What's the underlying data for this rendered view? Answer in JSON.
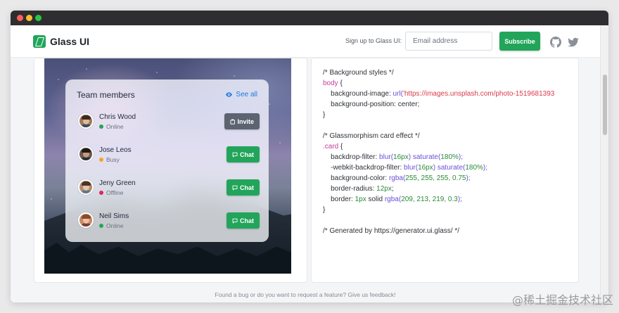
{
  "window": {
    "title": ""
  },
  "nav": {
    "brand": "Glass UI",
    "signup_label": "Sign up to Glass UI:",
    "email_placeholder": "Email address",
    "subscribe_label": "Subscribe",
    "icons": [
      "github-icon",
      "twitter-icon"
    ]
  },
  "card": {
    "title": "Team members",
    "see_all": "See all",
    "members": [
      {
        "name": "Chris Wood",
        "status": "Online",
        "status_color": "#22a55a",
        "action": "Invite"
      },
      {
        "name": "Jose Leos",
        "status": "Busy",
        "status_color": "#f5a524",
        "action": "Chat"
      },
      {
        "name": "Jeny Green",
        "status": "Offline",
        "status_color": "#e0245e",
        "action": "Chat"
      },
      {
        "name": "Neil Sims",
        "status": "Online",
        "status_color": "#22a55a",
        "action": "Chat"
      }
    ]
  },
  "code": {
    "l1": "/* Background styles */",
    "l2_sel": "body",
    "l2_brace": " {",
    "l3_prop": "    background-image: ",
    "l3_fn": "url(",
    "l3_str": "'https://images.unsplash.com/photo-1519681393",
    "l4": "    background-position: center;",
    "l5": "}",
    "l6": "/* Glassmorphism card effect */",
    "l7_sel": ".card",
    "l7_brace": " {",
    "l8_prop": "    backdrop-filter: ",
    "l8_fn1": "blur(",
    "l8_num1": "16px",
    "l8_fn1_end": ")",
    "l8_fn2": " saturate(",
    "l8_num2": "180%",
    "l8_end": ");",
    "l9_prop": "    -webkit-backdrop-filter: ",
    "l9_fn1": "blur(",
    "l9_num1": "16px",
    "l9_fn1_end": ")",
    "l9_fn2": " saturate(",
    "l9_num2": "180%",
    "l9_end": ");",
    "l10_prop": "    background-color: ",
    "l10_fn": "rgba(",
    "l10_num": "255, 255, 255, 0.75",
    "l10_end": ");",
    "l11_prop": "    border-radius: ",
    "l11_num": "12px",
    "l11_end": ";",
    "l12_prop": "    border: ",
    "l12_num": "1px",
    "l12_mid": " solid ",
    "l12_fn": "rgba(",
    "l12_num2": "209, 213, 219, 0.3",
    "l12_end": ");",
    "l13": "}",
    "l14": "/* Generated by https://generator.ui.glass/ */"
  },
  "footer": "Found a bug or do you want to request a feature? Give us feedback!",
  "watermark": "@稀土掘金技术社区",
  "colors": {
    "accent": "#22a55a",
    "link": "#1f7ae0",
    "invite": "#5b6470"
  }
}
